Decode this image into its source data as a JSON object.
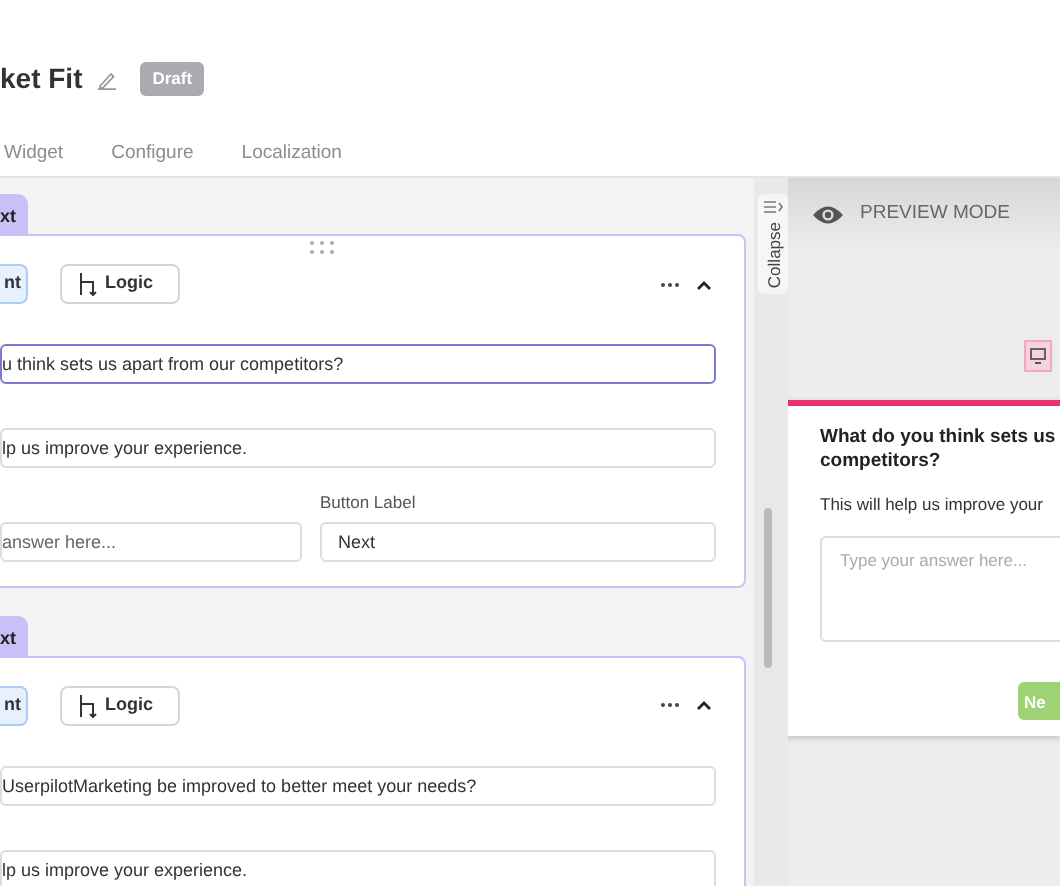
{
  "header": {
    "title": "ket Fit",
    "badge": "Draft"
  },
  "tabs": [
    {
      "label": "Widget",
      "selected": false
    },
    {
      "label": "Configure",
      "selected": false
    },
    {
      "label": "Localization",
      "selected": false
    }
  ],
  "questions": [
    {
      "tab": "xt",
      "buttons": [
        {
          "label": "nt",
          "selected": true
        },
        {
          "label": "Logic",
          "selected": false
        }
      ],
      "question": {
        "value": "u think sets us apart from our competitors?",
        "focused": true
      },
      "description": {
        "value": "lp us improve your experience."
      },
      "answer_field": {
        "placeholder": "answer here..."
      },
      "button_field": {
        "label": "Button Label",
        "value": "Next"
      }
    },
    {
      "tab": "xt",
      "buttons": [
        {
          "label": "nt",
          "selected": true
        },
        {
          "label": "Logic",
          "selected": false
        }
      ],
      "question": {
        "value": "UserpilotMarketing be improved to better meet your needs?",
        "focused": false
      },
      "description": {
        "value": "lp us improve your experience."
      }
    }
  ],
  "sidebar": {
    "collapse": "Collapse"
  },
  "preview": {
    "mode_label": "PREVIEW MODE",
    "survey": {
      "title": "What do you think sets us\ncompetitors?",
      "description": "This will help us improve your",
      "placeholder": "Type your answer here...",
      "button": "Ne"
    }
  }
}
